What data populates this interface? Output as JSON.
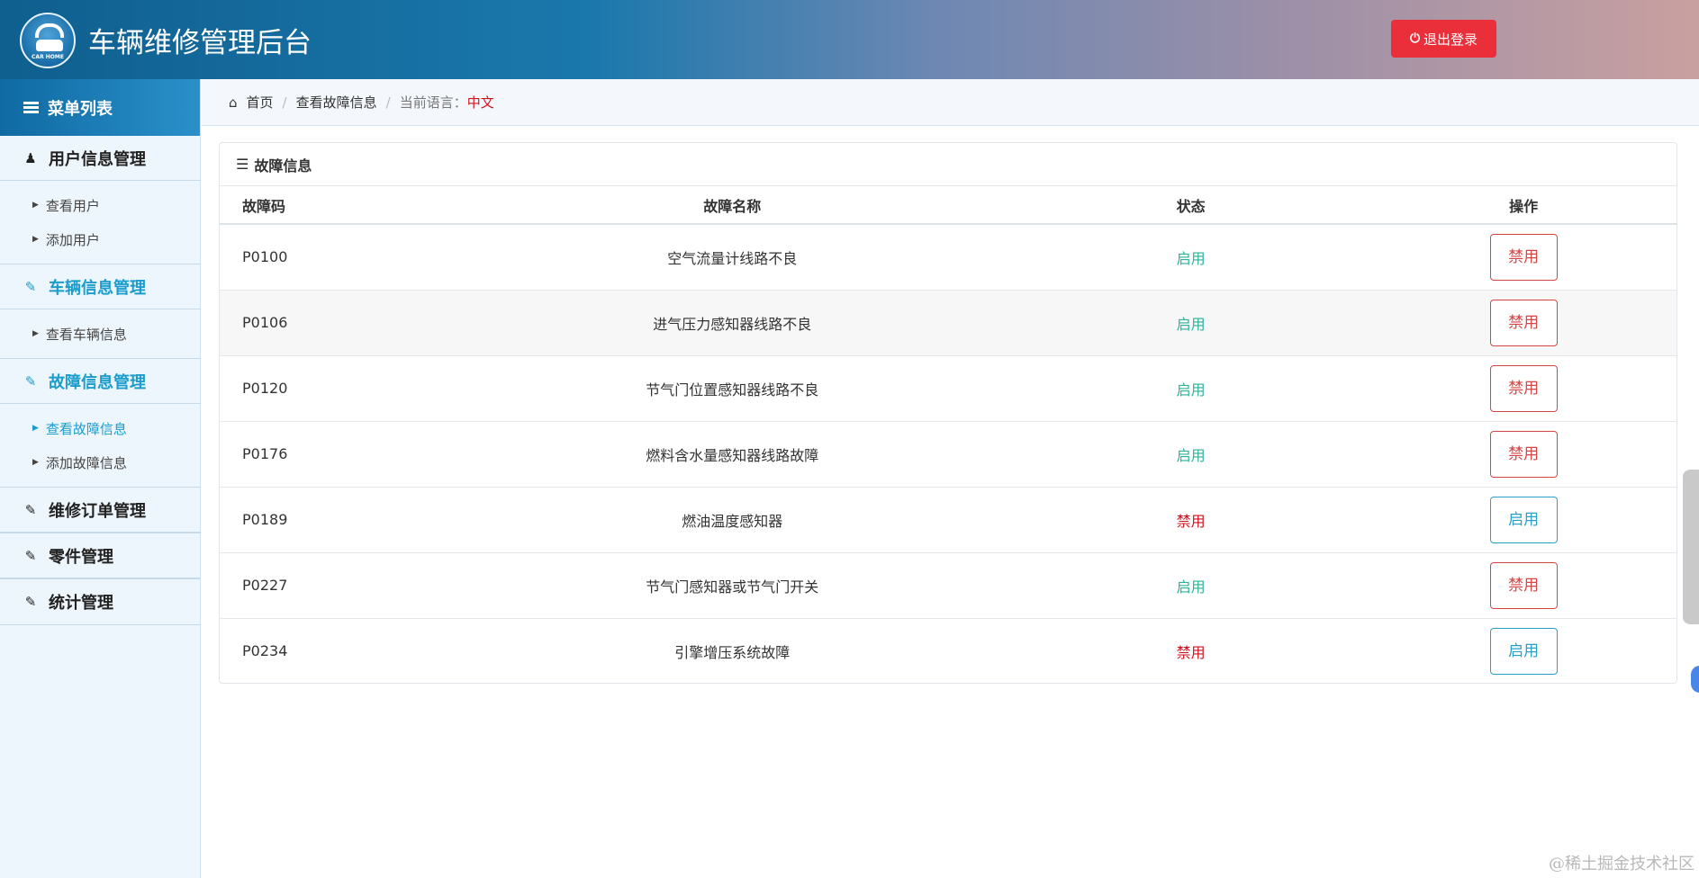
{
  "header": {
    "logo_caption": "CAR HOME",
    "title": "车辆维修管理后台",
    "logout_label": "退出登录"
  },
  "sidebar": {
    "menu_title": "菜单列表",
    "groups": [
      {
        "title": "用户信息管理",
        "icon": "user-icon",
        "items": [
          "查看用户",
          "添加用户"
        ]
      },
      {
        "title": "车辆信息管理",
        "icon": "edit-icon",
        "items": [
          "查看车辆信息"
        ]
      },
      {
        "title": "故障信息管理",
        "icon": "edit-icon",
        "items": [
          "查看故障信息",
          "添加故障信息"
        ]
      },
      {
        "title": "维修订单管理",
        "icon": "edit-icon",
        "items": []
      },
      {
        "title": "零件管理",
        "icon": "edit-icon",
        "items": []
      },
      {
        "title": "统计管理",
        "icon": "edit-icon",
        "items": []
      }
    ]
  },
  "breadcrumb": {
    "home": "首页",
    "current": "查看故障信息",
    "lang_label": "当前语言：",
    "lang_value": "中文"
  },
  "panel": {
    "title": "故障信息",
    "columns": [
      "故障码",
      "故障名称",
      "状态",
      "操作"
    ],
    "rows": [
      {
        "code": "P0100",
        "name": "空气流量计线路不良",
        "status": "启用",
        "action": "禁用"
      },
      {
        "code": "P0106",
        "name": "进气压力感知器线路不良",
        "status": "启用",
        "action": "禁用"
      },
      {
        "code": "P0120",
        "name": "节气门位置感知器线路不良",
        "status": "启用",
        "action": "禁用"
      },
      {
        "code": "P0176",
        "name": "燃料含水量感知器线路故障",
        "status": "启用",
        "action": "禁用"
      },
      {
        "code": "P0189",
        "name": "燃油温度感知器",
        "status": "禁用",
        "action": "启用"
      },
      {
        "code": "P0227",
        "name": "节气门感知器或节气门开关",
        "status": "启用",
        "action": "禁用"
      },
      {
        "code": "P0234",
        "name": "引擎增压系统故障",
        "status": "禁用",
        "action": "启用"
      }
    ]
  },
  "colors": {
    "status_enabled": "#2db39a",
    "status_disabled": "#d0121f",
    "logout_bg": "#ea2f3a",
    "active_menu": "#1a9ccc"
  },
  "watermark": "@稀土掘金技术社区"
}
